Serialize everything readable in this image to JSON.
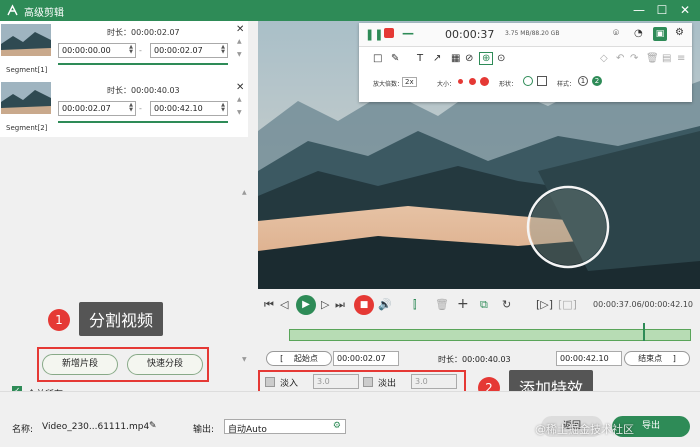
{
  "window": {
    "title": "高级剪辑",
    "minimize": "—",
    "maximize": "☐",
    "close": "✕"
  },
  "segments": [
    {
      "label": "Segment[1]",
      "duration_label": "时长：00:00:02.07",
      "start": "00:00:00.00",
      "end": "00:00:02.07"
    },
    {
      "label": "Segment[2]",
      "duration_label": "时长：00:00:40.03",
      "start": "00:00:02.07",
      "end": "00:00:42.10"
    }
  ],
  "callouts": [
    {
      "num": "1",
      "text": "分割视频"
    },
    {
      "num": "2",
      "text": "添加特效"
    }
  ],
  "split": {
    "add_segment": "新增片段",
    "quick_split": "快速分段"
  },
  "merge_all": "合并所有",
  "recorder": {
    "time": "00:00:37",
    "size": "3.75 MB/88.20 GB",
    "zoom_label": "放大倍数：",
    "zoom_value": "2x",
    "size_label": "大小：",
    "shape_label": "形状：",
    "style_label": "样式：",
    "step_1": "1",
    "step_2": "2"
  },
  "player": {
    "time_display": "00:00:37.06/00:00:42.10"
  },
  "trim": {
    "start_label": "起始点",
    "start_value": "00:00:02.07",
    "duration_label": "时长：00:00:40.03",
    "end_value": "00:00:42.10",
    "end_label": "结束点",
    "bracket_left": "[",
    "bracket_right": "]",
    "progress_fraction": 0.88
  },
  "effects": {
    "fade_in_label": "淡入",
    "fade_in_value": "3.0",
    "fade_out_label": "淡出",
    "fade_out_value": "3.0"
  },
  "footer": {
    "name_label": "名称:",
    "name_value": "Video_230...61111.mp4",
    "output_label": "输出:",
    "output_value": "自动Auto",
    "back_button": "返回",
    "export_button": "导出",
    "watermark": "@稀土掘金技术社区"
  },
  "colors": {
    "accent": "#2e8b57",
    "callout": "#e53935",
    "callout_label_bg": "#555555"
  }
}
